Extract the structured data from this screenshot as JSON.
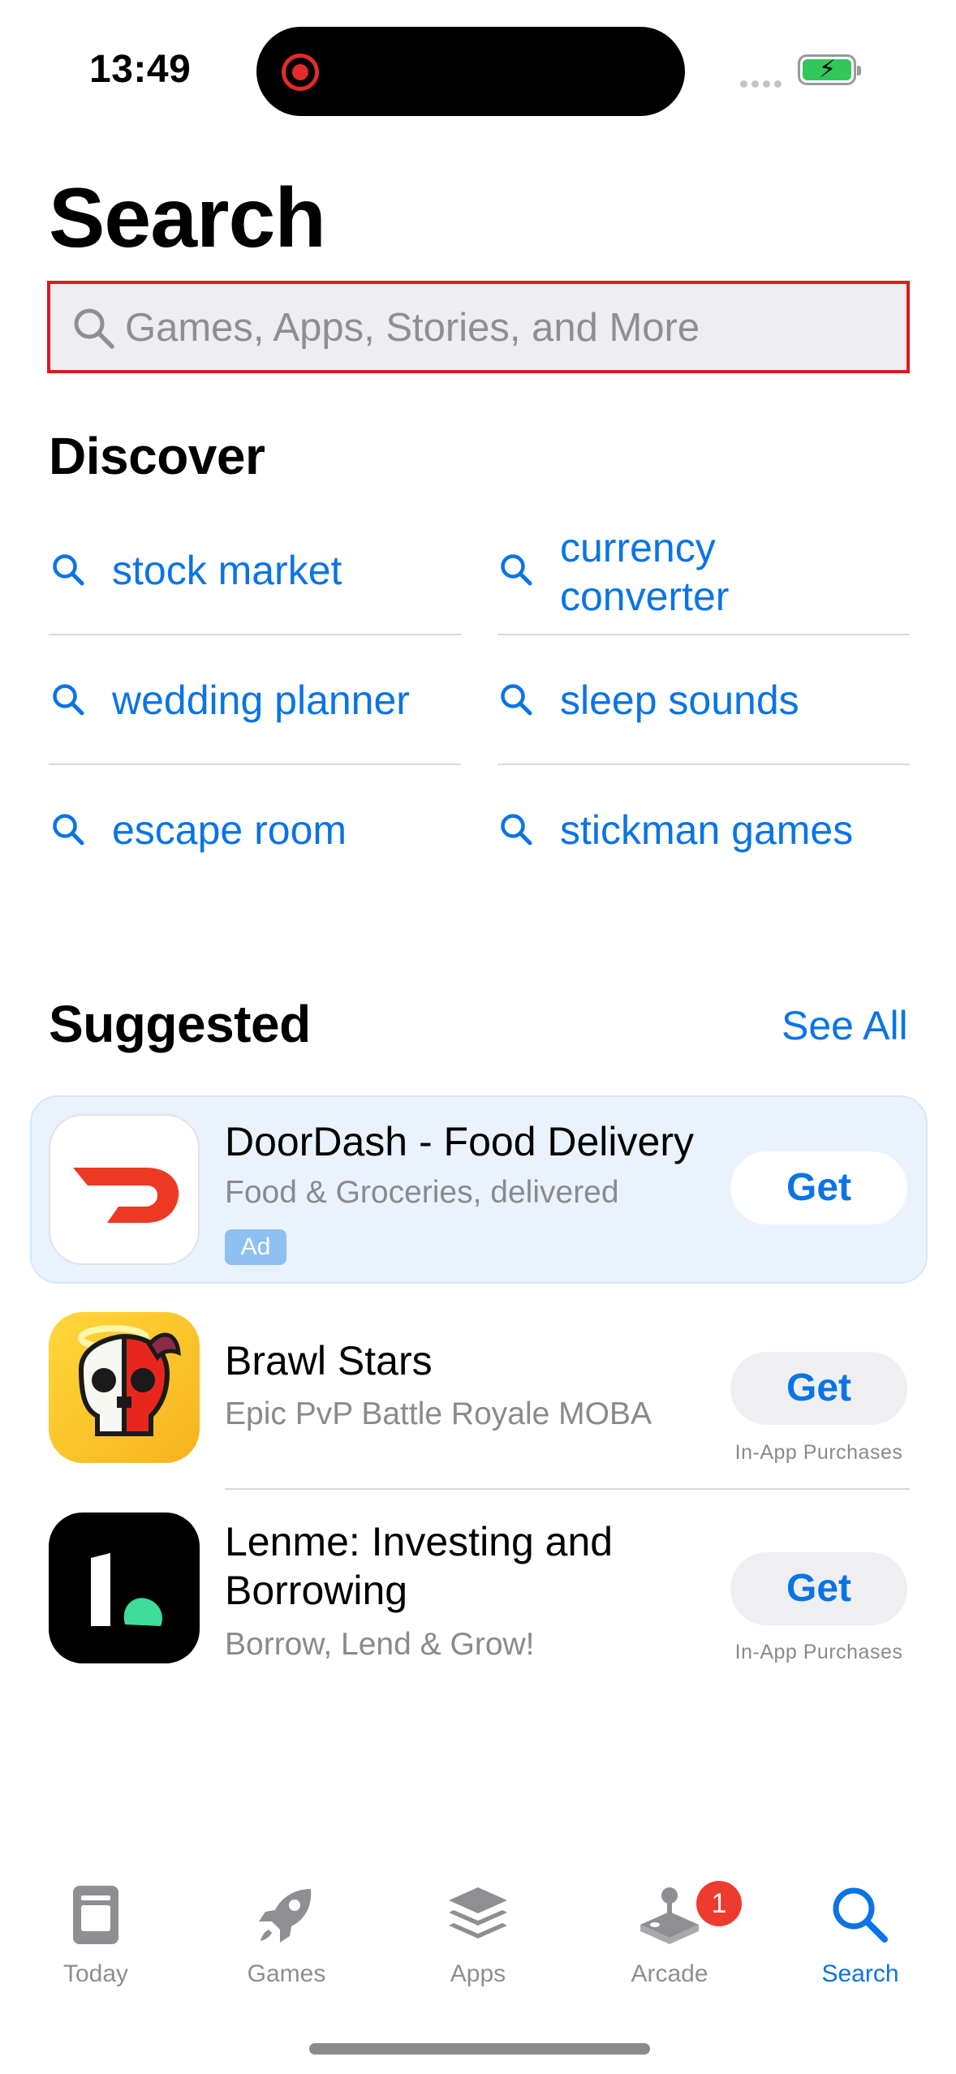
{
  "status_bar": {
    "time": "13:49"
  },
  "header": {
    "title": "Search"
  },
  "search": {
    "placeholder": "Games, Apps, Stories, and More"
  },
  "discover": {
    "title": "Discover",
    "items": [
      {
        "label": "stock market"
      },
      {
        "label": "currency converter"
      },
      {
        "label": "wedding planner"
      },
      {
        "label": "sleep sounds"
      },
      {
        "label": "escape room"
      },
      {
        "label": "stickman games"
      }
    ]
  },
  "suggested": {
    "title": "Suggested",
    "see_all": "See All",
    "apps": [
      {
        "name": "DoorDash - Food Delivery",
        "subtitle": "Food & Groceries, delivered",
        "badge": "Ad",
        "action": "Get",
        "note": ""
      },
      {
        "name": "Brawl Stars",
        "subtitle": "Epic PvP Battle Royale MOBA",
        "action": "Get",
        "note": "In-App Purchases"
      },
      {
        "name": "Lenme: Investing and Borrowing",
        "subtitle": "Borrow, Lend & Grow!",
        "action": "Get",
        "note": "In-App Purchases"
      }
    ]
  },
  "tab_bar": {
    "tabs": [
      {
        "label": "Today",
        "icon": "today-icon"
      },
      {
        "label": "Games",
        "icon": "rocket-icon"
      },
      {
        "label": "Apps",
        "icon": "apps-stack-icon"
      },
      {
        "label": "Arcade",
        "icon": "arcade-joystick-icon",
        "badge": "1"
      },
      {
        "label": "Search",
        "icon": "search-icon",
        "active": true
      }
    ]
  },
  "colors": {
    "accent": "#0a74e6",
    "badge": "#ee3b30",
    "ad_background": "#eaf3fd",
    "highlight_border": "#e01a1a"
  }
}
